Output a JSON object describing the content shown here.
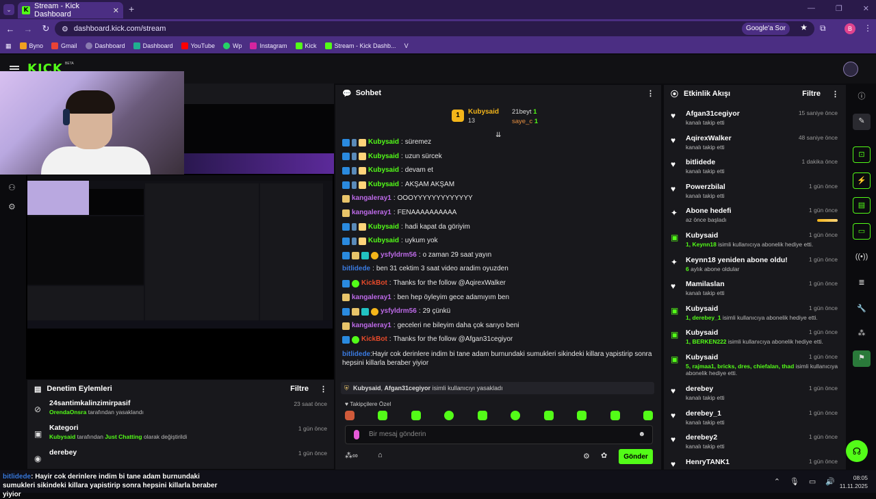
{
  "browser": {
    "tab_title": "Stream - Kick Dashboard",
    "url": "dashboard.kick.com/stream",
    "google_pill": "Google'a Sor",
    "profile_letter": "B",
    "bookmarks": [
      "Byno",
      "Gmail",
      "Dashboard",
      "Dashboard",
      "YouTube",
      "Wp",
      "Instagram",
      "Kick",
      "Stream - Kick Dashb...",
      "V"
    ]
  },
  "kick": {
    "logo": "KICK",
    "beta": "BETA"
  },
  "moderation": {
    "title": "Denetim Eylemleri",
    "filter": "Filtre",
    "items": [
      {
        "title": "24santimkalinzimirpasif",
        "actor": "OrendaOnsra",
        "desc": "tarafından yasaklandı",
        "time": "23 saat önce"
      },
      {
        "title": "Kategori",
        "actor": "Kubysaid",
        "desc_pre": "tarafından",
        "target": "Just Chatting",
        "desc": "olarak değiştirildi",
        "time": "1 gün önce"
      },
      {
        "title": "derebey",
        "time": "1 gün önce"
      }
    ]
  },
  "chat": {
    "title": "Sohbet",
    "leaders": [
      {
        "rank": "1",
        "name": "Kubysaid",
        "count": "13"
      },
      {
        "name": "21beyt",
        "count": "1"
      },
      {
        "name": "saye_c",
        "count": "1"
      }
    ],
    "messages": [
      {
        "user": "Kubysaid",
        "text": "süremez",
        "style": "g",
        "badges": 3
      },
      {
        "user": "Kubysaid",
        "text": "uzun sürcek",
        "style": "g",
        "badges": 3
      },
      {
        "user": "Kubysaid",
        "text": "devam et",
        "style": "g",
        "badges": 3
      },
      {
        "user": "Kubysaid",
        "text": "AKŞAM AKŞAM",
        "style": "g",
        "badges": 3
      },
      {
        "user": "kangaleray1",
        "text": "OOOYYYYYYYYYYYYY",
        "style": "p",
        "badges": 1
      },
      {
        "user": "kangaleray1",
        "text": "FENAAAAAAAAAA",
        "style": "p",
        "badges": 1
      },
      {
        "user": "Kubysaid",
        "text": "hadi kapat da göriyim",
        "style": "g",
        "badges": 3
      },
      {
        "user": "Kubysaid",
        "text": "uykum yok",
        "style": "g",
        "badges": 3
      },
      {
        "user": "ysfyldrm56",
        "text": "o zaman 29 saat yayın",
        "style": "p",
        "badges": 4
      },
      {
        "user": "bitlidede",
        "text": "ben 31 cektim 3 saat video aradim oyuzden",
        "style": "b",
        "badges": 0
      },
      {
        "user": "KickBot",
        "text": "Thanks for the follow @AqirexWalker",
        "style": "r",
        "badges": 2
      },
      {
        "user": "kangaleray1",
        "text": "ben hep öyleyim gece adamıyım ben",
        "style": "p",
        "badges": 1
      },
      {
        "user": "ysfyldrm56",
        "text": "29 çünkü",
        "style": "p",
        "badges": 4
      },
      {
        "user": "kangaleray1",
        "text": "geceleri ne bileyim daha çok sarıyo beni",
        "style": "p",
        "badges": 1
      },
      {
        "user": "KickBot",
        "text": "Thanks for the follow @Afgan31cegiyor",
        "style": "r",
        "badges": 2
      },
      {
        "user": "bitlidede",
        "text": "Hayir cok derinlere indim bi tane adam burnundaki sumukleri sikindeki killara yapistirip sonra hepsini killarla beraber yiyior",
        "style": "b",
        "badges": 0,
        "multi": true
      }
    ],
    "ban_notice": {
      "actor": "Kubysaid",
      "target": "Afgan31cegiyor",
      "text": "isimli kullanıcıyı yasakladı"
    },
    "sub_only_label": "Takipçilere Özel",
    "input_placeholder": "Bir mesaj gönderin",
    "send_label": "Gönder"
  },
  "activity": {
    "title": "Etkinlik Akışı",
    "filter": "Filtre",
    "items": [
      {
        "name": "Afgan31cegiyor",
        "desc": "kanalı takip etti",
        "time": "15 saniye önce",
        "icon": "heart"
      },
      {
        "name": "AqirexWalker",
        "desc": "kanalı takip etti",
        "time": "48 saniye önce",
        "icon": "heart"
      },
      {
        "name": "bitlidede",
        "desc": "kanalı takip etti",
        "time": "1 dakika önce",
        "icon": "heart"
      },
      {
        "name": "Powerzbilal",
        "desc": "kanalı takip etti",
        "time": "1 gün önce",
        "icon": "heart"
      },
      {
        "name": "Abone hedefi",
        "desc": "az önce başladı",
        "time": "1 gün önce",
        "icon": "sparkle"
      },
      {
        "name": "Kubysaid",
        "hl": "1, Keynn18",
        "desc": "isimli kullanıcıya abonelik hediye etti.",
        "time": "1 gün önce",
        "icon": "gift"
      },
      {
        "name": "Keynn18 yeniden abone oldu!",
        "hl": "6",
        "desc": "aylık abone oldular",
        "time": "1 gün önce",
        "icon": "sparkle"
      },
      {
        "name": "Mamilaslan",
        "desc": "kanalı takip etti",
        "time": "1 gün önce",
        "icon": "heart"
      },
      {
        "name": "Kubysaid",
        "hl": "1, derebey_1",
        "desc": "isimli kullanıcıya abonelik hediye etti.",
        "time": "1 gün önce",
        "icon": "gift"
      },
      {
        "name": "Kubysaid",
        "hl": "1, BERKEN222",
        "desc": "isimli kullanıcıya abonelik hediye etti.",
        "time": "1 gün önce",
        "icon": "gift"
      },
      {
        "name": "Kubysaid",
        "hl": "5, rajmaa1, bricks, dres, chiefalan, thad",
        "desc": "isimli kullanıcıya abonelik hediye etti.",
        "time": "1 gün önce",
        "icon": "gift",
        "tall": true
      },
      {
        "name": "derebey",
        "desc": "kanalı takip etti",
        "time": "1 gün önce",
        "icon": "heart"
      },
      {
        "name": "derebey_1",
        "desc": "kanalı takip etti",
        "time": "1 gün önce",
        "icon": "heart"
      },
      {
        "name": "derebey2",
        "desc": "kanalı takip etti",
        "time": "1 gün önce",
        "icon": "heart"
      },
      {
        "name": "HenryTANK1",
        "desc": "",
        "time": "1 gün önce",
        "icon": "heart"
      }
    ]
  },
  "ticker": {
    "user": "bitlidede",
    "text": ": Hayir cok derinlere indim bi tane adam burnundaki sumukleri sikindeki killara yapistirip sonra hepsini killarla beraber yiyior"
  },
  "taskbar": {
    "time": "08:05",
    "date": "11.11.2025"
  },
  "colors": {
    "accent": "#53fc18",
    "browser": "#4b2e83",
    "panel": "#18181c"
  }
}
